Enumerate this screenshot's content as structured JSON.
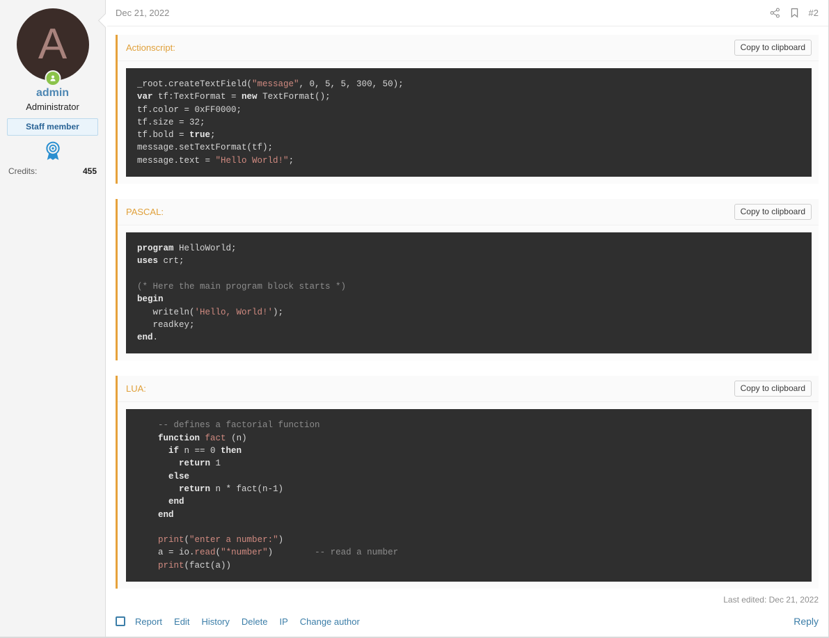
{
  "sidebar": {
    "avatar_letter": "A",
    "avatar_bg": "#3b2c28",
    "avatar_fg": "#a9837d",
    "online_icon": "user-online-icon",
    "username": "admin",
    "user_title": "Administrator",
    "staff_banner": "Staff member",
    "badge_icon": "award-ribbon-icon",
    "stats": [
      {
        "label": "Credits:",
        "value": "455"
      }
    ]
  },
  "header": {
    "date": "Dec 21, 2022",
    "share_icon": "share-icon",
    "bookmark_icon": "bookmark-icon",
    "post_number": "#2"
  },
  "code_blocks": [
    {
      "title": "Actionscript:",
      "copy_label": "Copy to clipboard",
      "language": "actionscript",
      "code": "_root.createTextField(\"message\", 0, 5, 5, 300, 50);\nvar tf:TextFormat = new TextFormat();\ntf.color = 0xFF0000;\ntf.size = 32;\ntf.bold = true;\nmessage.setTextFormat(tf);\nmessage.text = \"Hello World!\";"
    },
    {
      "title": "PASCAL:",
      "copy_label": "Copy to clipboard",
      "language": "pascal",
      "code": "program HelloWorld;\nuses crt;\n\n(* Here the main program block starts *)\nbegin\n   writeln('Hello, World!');\n   readkey;\nend."
    },
    {
      "title": "LUA:",
      "copy_label": "Copy to clipboard",
      "language": "lua",
      "code": "    -- defines a factorial function\n    function fact (n)\n      if n == 0 then\n        return 1\n      else\n        return n * fact(n-1)\n      end\n    end\n\n    print(\"enter a number:\")\n    a = io.read(\"*number\")        -- read a number\n    print(fact(a))"
    }
  ],
  "footer": {
    "last_edited": "Last edited: Dec 21, 2022",
    "select_checkbox": "",
    "actions": [
      "Report",
      "Edit",
      "History",
      "Delete",
      "IP",
      "Change author"
    ],
    "reply_label": "Reply"
  },
  "colors": {
    "accent_orange": "#e6a23c",
    "link_blue": "#3c7ea8",
    "code_bg": "#2f2f2f",
    "sidebar_bg": "#f4f4f4"
  }
}
